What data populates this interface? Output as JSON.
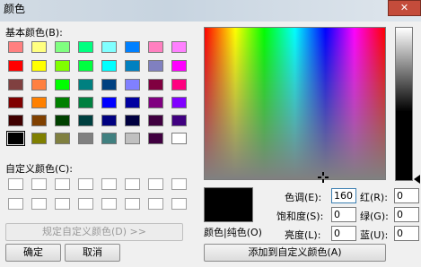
{
  "window": {
    "title": "颜色",
    "close_glyph": "✕"
  },
  "basic_colors": {
    "label": "基本颜色(B):",
    "rows": [
      [
        "#ff8080",
        "#ffff80",
        "#80ff80",
        "#00ff80",
        "#80ffff",
        "#0080ff",
        "#ff80c0",
        "#ff80ff"
      ],
      [
        "#ff0000",
        "#ffff00",
        "#80ff00",
        "#00ff40",
        "#00ffff",
        "#0080c0",
        "#8080c0",
        "#ff00ff"
      ],
      [
        "#804040",
        "#ff8040",
        "#00ff00",
        "#008080",
        "#004080",
        "#8080ff",
        "#800040",
        "#ff0080"
      ],
      [
        "#800000",
        "#ff8000",
        "#008000",
        "#008040",
        "#0000ff",
        "#0000a0",
        "#800080",
        "#8000ff"
      ],
      [
        "#400000",
        "#804000",
        "#004000",
        "#004040",
        "#000080",
        "#000040",
        "#400040",
        "#400080"
      ],
      [
        "#000000",
        "#808000",
        "#808040",
        "#808080",
        "#408080",
        "#c0c0c0",
        "#400040",
        "#ffffff"
      ]
    ],
    "selected": "#000000"
  },
  "custom_colors": {
    "label": "自定义颜色(C):"
  },
  "buttons": {
    "define_custom": "规定自定义颜色(D) >>",
    "ok": "确定",
    "cancel": "取消",
    "add_custom": "添加到自定义颜色(A)"
  },
  "preview_label": "颜色|纯色(O)",
  "fields": {
    "hue": {
      "label": "色调(E):",
      "value": "160"
    },
    "sat": {
      "label": "饱和度(S):",
      "value": "0"
    },
    "lum": {
      "label": "亮度(L):",
      "value": "0"
    },
    "red": {
      "label": "红(R):",
      "value": "0"
    },
    "green": {
      "label": "绿(G):",
      "value": "0"
    },
    "blue": {
      "label": "蓝(U):",
      "value": "0"
    }
  },
  "colors": {
    "selected_color": "#000000",
    "hue_field_border": "#3c7fb1"
  }
}
